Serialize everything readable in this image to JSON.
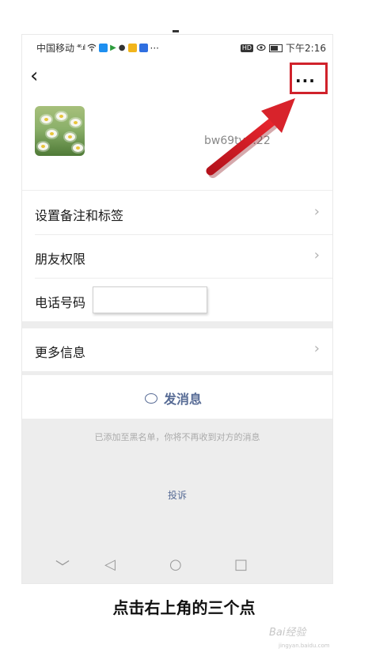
{
  "status_bar": {
    "carrier": "中国移动",
    "signal": "⁴⁶.ıl",
    "more": "···",
    "hd": "HD",
    "time": "下午2:16"
  },
  "nav": {
    "back_icon": "‹",
    "more_icon": "···"
  },
  "profile": {
    "wechat_id": "bw69tv…22"
  },
  "rows": {
    "remark_label": "设置备注和标签",
    "permission_label": "朋友权限",
    "phone_label": "电话号码",
    "more_info_label": "更多信息",
    "chevron": "›"
  },
  "message": {
    "label": "发消息"
  },
  "notice": {
    "blacklist_text": "已添加至黑名单，你将不再收到对方的消息",
    "report_label": "投诉"
  },
  "android_nav": {
    "down": "﹀",
    "back": "◁",
    "home": "○",
    "recent": "□"
  },
  "caption": "点击右上角的三个点",
  "watermark": {
    "main": "Bai经验",
    "sub": "jingyan.baidu.com"
  },
  "colors": {
    "accent_link": "#576b95",
    "highlight": "#d0222b",
    "background_grey": "#ededed"
  }
}
